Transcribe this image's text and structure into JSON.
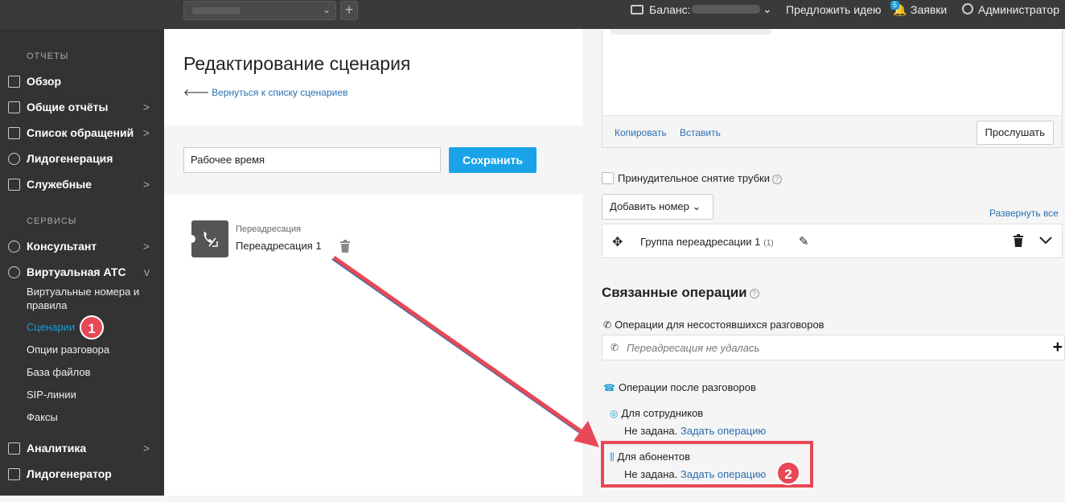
{
  "topbar": {
    "balance_label": "Баланс:",
    "suggest_idea": "Предложить идею",
    "requests_badge": "5",
    "requests_label": "Заявки",
    "user_label": "Администратор"
  },
  "sidebar": {
    "reports_section": "ОТЧЕТЫ",
    "services_section": "СЕРВИСЫ",
    "items": [
      {
        "label": "Обзор",
        "icon": "info-icon"
      },
      {
        "label": "Общие отчёты",
        "icon": "chart-icon"
      },
      {
        "label": "Список обращений",
        "icon": "list-icon"
      },
      {
        "label": "Лидогенерация",
        "icon": "gear-icon"
      },
      {
        "label": "Служебные",
        "icon": "code-icon"
      },
      {
        "label": "Консультант",
        "icon": "chat-icon"
      },
      {
        "label": "Виртуальная АТС",
        "icon": "phone-icon"
      },
      {
        "label": "Аналитика",
        "icon": "puzzle-icon"
      },
      {
        "label": "Лидогенератор",
        "icon": "calendar-icon"
      }
    ],
    "ats_sub": [
      {
        "label": "Виртуальные номера и правила"
      },
      {
        "label": "Сценарии"
      },
      {
        "label": "Опции разговора"
      },
      {
        "label": "База файлов"
      },
      {
        "label": "SIP-линии"
      },
      {
        "label": "Факсы"
      }
    ],
    "badge1": "1"
  },
  "center": {
    "title": "Редактирование сценария",
    "back_link": "Вернуться к списку сценариев",
    "name_value": "Рабочее время",
    "save_label": "Сохранить",
    "node_type": "Переадресация",
    "node_name": "Переадресация 1"
  },
  "right": {
    "copy": "Копировать",
    "paste": "Вставить",
    "listen": "Прослушать",
    "force_hangup": "Принудительное снятие трубки",
    "add_number": "Добавить номер",
    "expand_all": "Развернуть все",
    "group_name": "Группа переадресации 1",
    "group_count": "(1)",
    "related_ops": "Связанные операции",
    "failed_ops_label": "Операции для несостоявшихся разговоров",
    "failed_ops_placeholder": "Переадресация не удалась",
    "after_ops_label": "Операции после разговоров",
    "for_employees": "Для сотрудников",
    "for_subscribers": "Для абонентов",
    "not_set": "Не задана.",
    "set_op": "Задать операцию",
    "badge2": "2"
  },
  "colors": {
    "accent": "#1aa3e8",
    "annotation": "#e84855",
    "sidebar_bg": "#333333"
  }
}
